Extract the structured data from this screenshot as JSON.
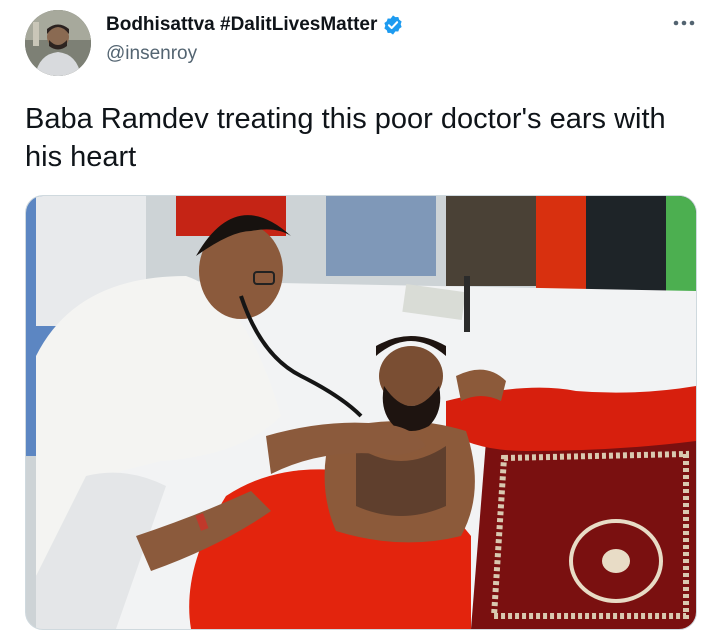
{
  "tweet": {
    "author": {
      "display_name": "Bodhisattva #DalitLivesMatter",
      "handle": "@insenroy",
      "verified": true,
      "avatar_icon": "user-avatar"
    },
    "more_icon": "more-options-icon",
    "text": "Baba Ramdev treating this poor doctor's ears with his heart",
    "media": {
      "kind": "photo"
    }
  },
  "colors": {
    "verified_blue": "#1d9bf0",
    "handle_gray": "#536471",
    "text_dark": "#0f1419",
    "saffron": "#e8230f",
    "carpet_red": "#7a1010"
  }
}
